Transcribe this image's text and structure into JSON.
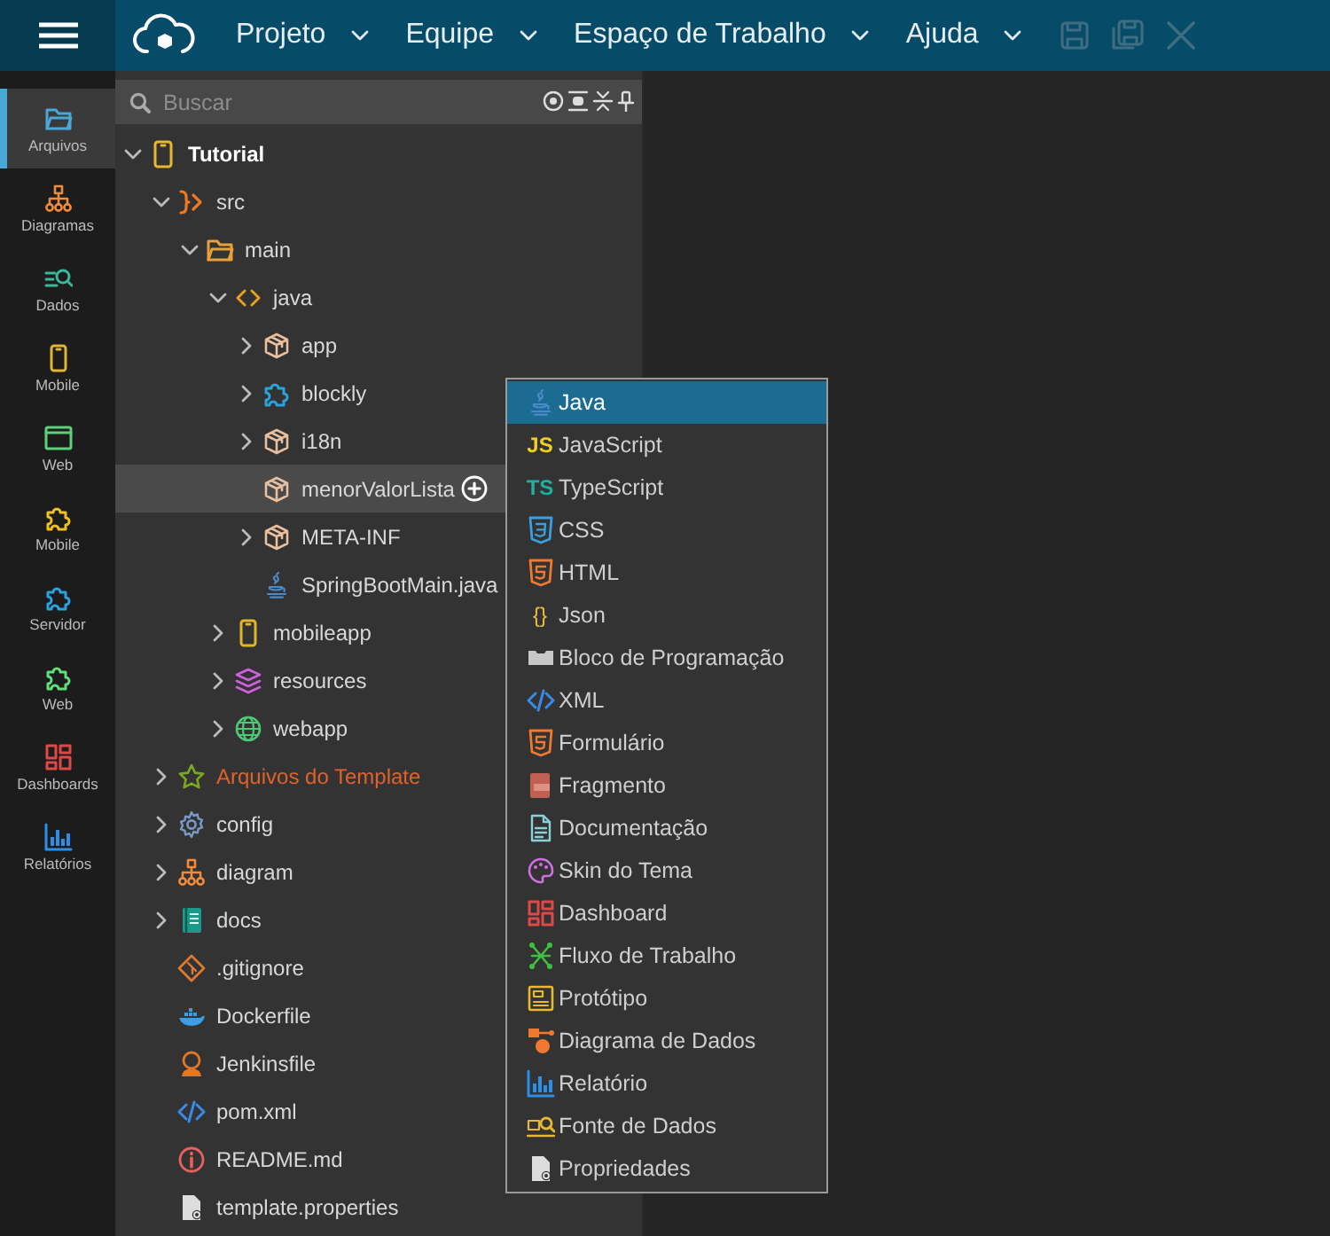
{
  "topbar": {
    "menus": [
      {
        "label": "Projeto"
      },
      {
        "label": "Equipe"
      },
      {
        "label": "Espaço de Trabalho"
      },
      {
        "label": "Ajuda"
      }
    ],
    "actions": [
      {
        "kind": "save",
        "disabled": true
      },
      {
        "kind": "saveall",
        "disabled": true
      },
      {
        "kind": "close",
        "disabled": true
      }
    ]
  },
  "sidebar": {
    "items": [
      {
        "label": "Arquivos",
        "kind": "files",
        "selected": true
      },
      {
        "label": "Diagramas",
        "kind": "diagram",
        "selected": false
      },
      {
        "label": "Dados",
        "kind": "data",
        "selected": false
      },
      {
        "label": "Mobile",
        "kind": "phone",
        "selected": false
      },
      {
        "label": "Web",
        "kind": "browser",
        "selected": false
      },
      {
        "label": "Mobile",
        "kind": "puzzleyellow",
        "selected": false
      },
      {
        "label": "Servidor",
        "kind": "puzzleblue",
        "selected": false
      },
      {
        "label": "Web",
        "kind": "puzzlegreen",
        "selected": false
      },
      {
        "label": "Dashboards",
        "kind": "dashboard",
        "selected": false
      },
      {
        "label": "Relatórios",
        "kind": "report",
        "selected": false
      }
    ]
  },
  "search": {
    "placeholder": "Buscar"
  },
  "tree": [
    {
      "label": "Tutorial",
      "kind": "project",
      "expanded": true,
      "selected": false,
      "children": [
        {
          "label": "src",
          "kind": "source",
          "expanded": true,
          "selected": false,
          "children": [
            {
              "label": "main",
              "kind": "folder",
              "expanded": true,
              "selected": false,
              "children": [
                {
                  "label": "java",
                  "kind": "code",
                  "expanded": true,
                  "selected": false,
                  "children": [
                    {
                      "label": "app",
                      "kind": "package",
                      "expanded": false,
                      "selected": false
                    },
                    {
                      "label": "blockly",
                      "kind": "puzzle",
                      "expanded": false,
                      "selected": false
                    },
                    {
                      "label": "i18n",
                      "kind": "package",
                      "expanded": false,
                      "selected": false
                    },
                    {
                      "label": "menorValorLista",
                      "kind": "package",
                      "selected": true
                    },
                    {
                      "label": "META-INF",
                      "kind": "package",
                      "expanded": false,
                      "selected": false
                    },
                    {
                      "label": "SpringBootMain.java",
                      "kind": "java",
                      "selected": false
                    }
                  ]
                },
                {
                  "label": "mobileapp",
                  "kind": "phone",
                  "expanded": false,
                  "selected": false
                },
                {
                  "label": "resources",
                  "kind": "layers",
                  "expanded": false,
                  "selected": false
                },
                {
                  "label": "webapp",
                  "kind": "globe",
                  "expanded": false,
                  "selected": false
                }
              ]
            }
          ]
        },
        {
          "label": "Arquivos do Template",
          "kind": "template",
          "expanded": false,
          "selected": false
        },
        {
          "label": "config",
          "kind": "gear",
          "expanded": false,
          "selected": false
        },
        {
          "label": "diagram",
          "kind": "diagram",
          "expanded": false,
          "selected": false
        },
        {
          "label": "docs",
          "kind": "book",
          "expanded": false,
          "selected": false
        },
        {
          "label": ".gitignore",
          "kind": "git",
          "selected": false
        },
        {
          "label": "Dockerfile",
          "kind": "docker",
          "selected": false
        },
        {
          "label": "Jenkinsfile",
          "kind": "jenkins",
          "selected": false
        },
        {
          "label": "pom.xml",
          "kind": "xml",
          "selected": false
        },
        {
          "label": "README.md",
          "kind": "info",
          "selected": false
        },
        {
          "label": "template.properties",
          "kind": "props",
          "selected": false
        }
      ]
    }
  ],
  "context_menu": {
    "items": [
      {
        "label": "Java",
        "kind": "java",
        "selected": true
      },
      {
        "label": "JavaScript",
        "kind": "js",
        "icon_text": "JS",
        "selected": false
      },
      {
        "label": "TypeScript",
        "kind": "ts",
        "icon_text": "TS",
        "selected": false
      },
      {
        "label": "CSS",
        "kind": "css",
        "selected": false
      },
      {
        "label": "HTML",
        "kind": "html",
        "selected": false
      },
      {
        "label": "Json",
        "kind": "json",
        "icon_text": "{}",
        "selected": false
      },
      {
        "label": "Bloco de Programação",
        "kind": "block",
        "selected": false
      },
      {
        "label": "XML",
        "kind": "xml",
        "selected": false
      },
      {
        "label": "Formulário",
        "kind": "html",
        "selected": false
      },
      {
        "label": "Fragmento",
        "kind": "fragment",
        "selected": false
      },
      {
        "label": "Documentação",
        "kind": "doc",
        "selected": false
      },
      {
        "label": "Skin do Tema",
        "kind": "palette",
        "selected": false
      },
      {
        "label": "Dashboard",
        "kind": "dashboard",
        "selected": false
      },
      {
        "label": "Fluxo de Trabalho",
        "kind": "flow",
        "selected": false
      },
      {
        "label": "Protótipo",
        "kind": "prototype",
        "selected": false
      },
      {
        "label": "Diagrama de Dados",
        "kind": "datadiagram",
        "selected": false
      },
      {
        "label": "Relatório",
        "kind": "report",
        "selected": false
      },
      {
        "label": "Fonte de Dados",
        "kind": "datasource",
        "selected": false
      },
      {
        "label": "Propriedades",
        "kind": "props",
        "selected": false
      }
    ]
  }
}
